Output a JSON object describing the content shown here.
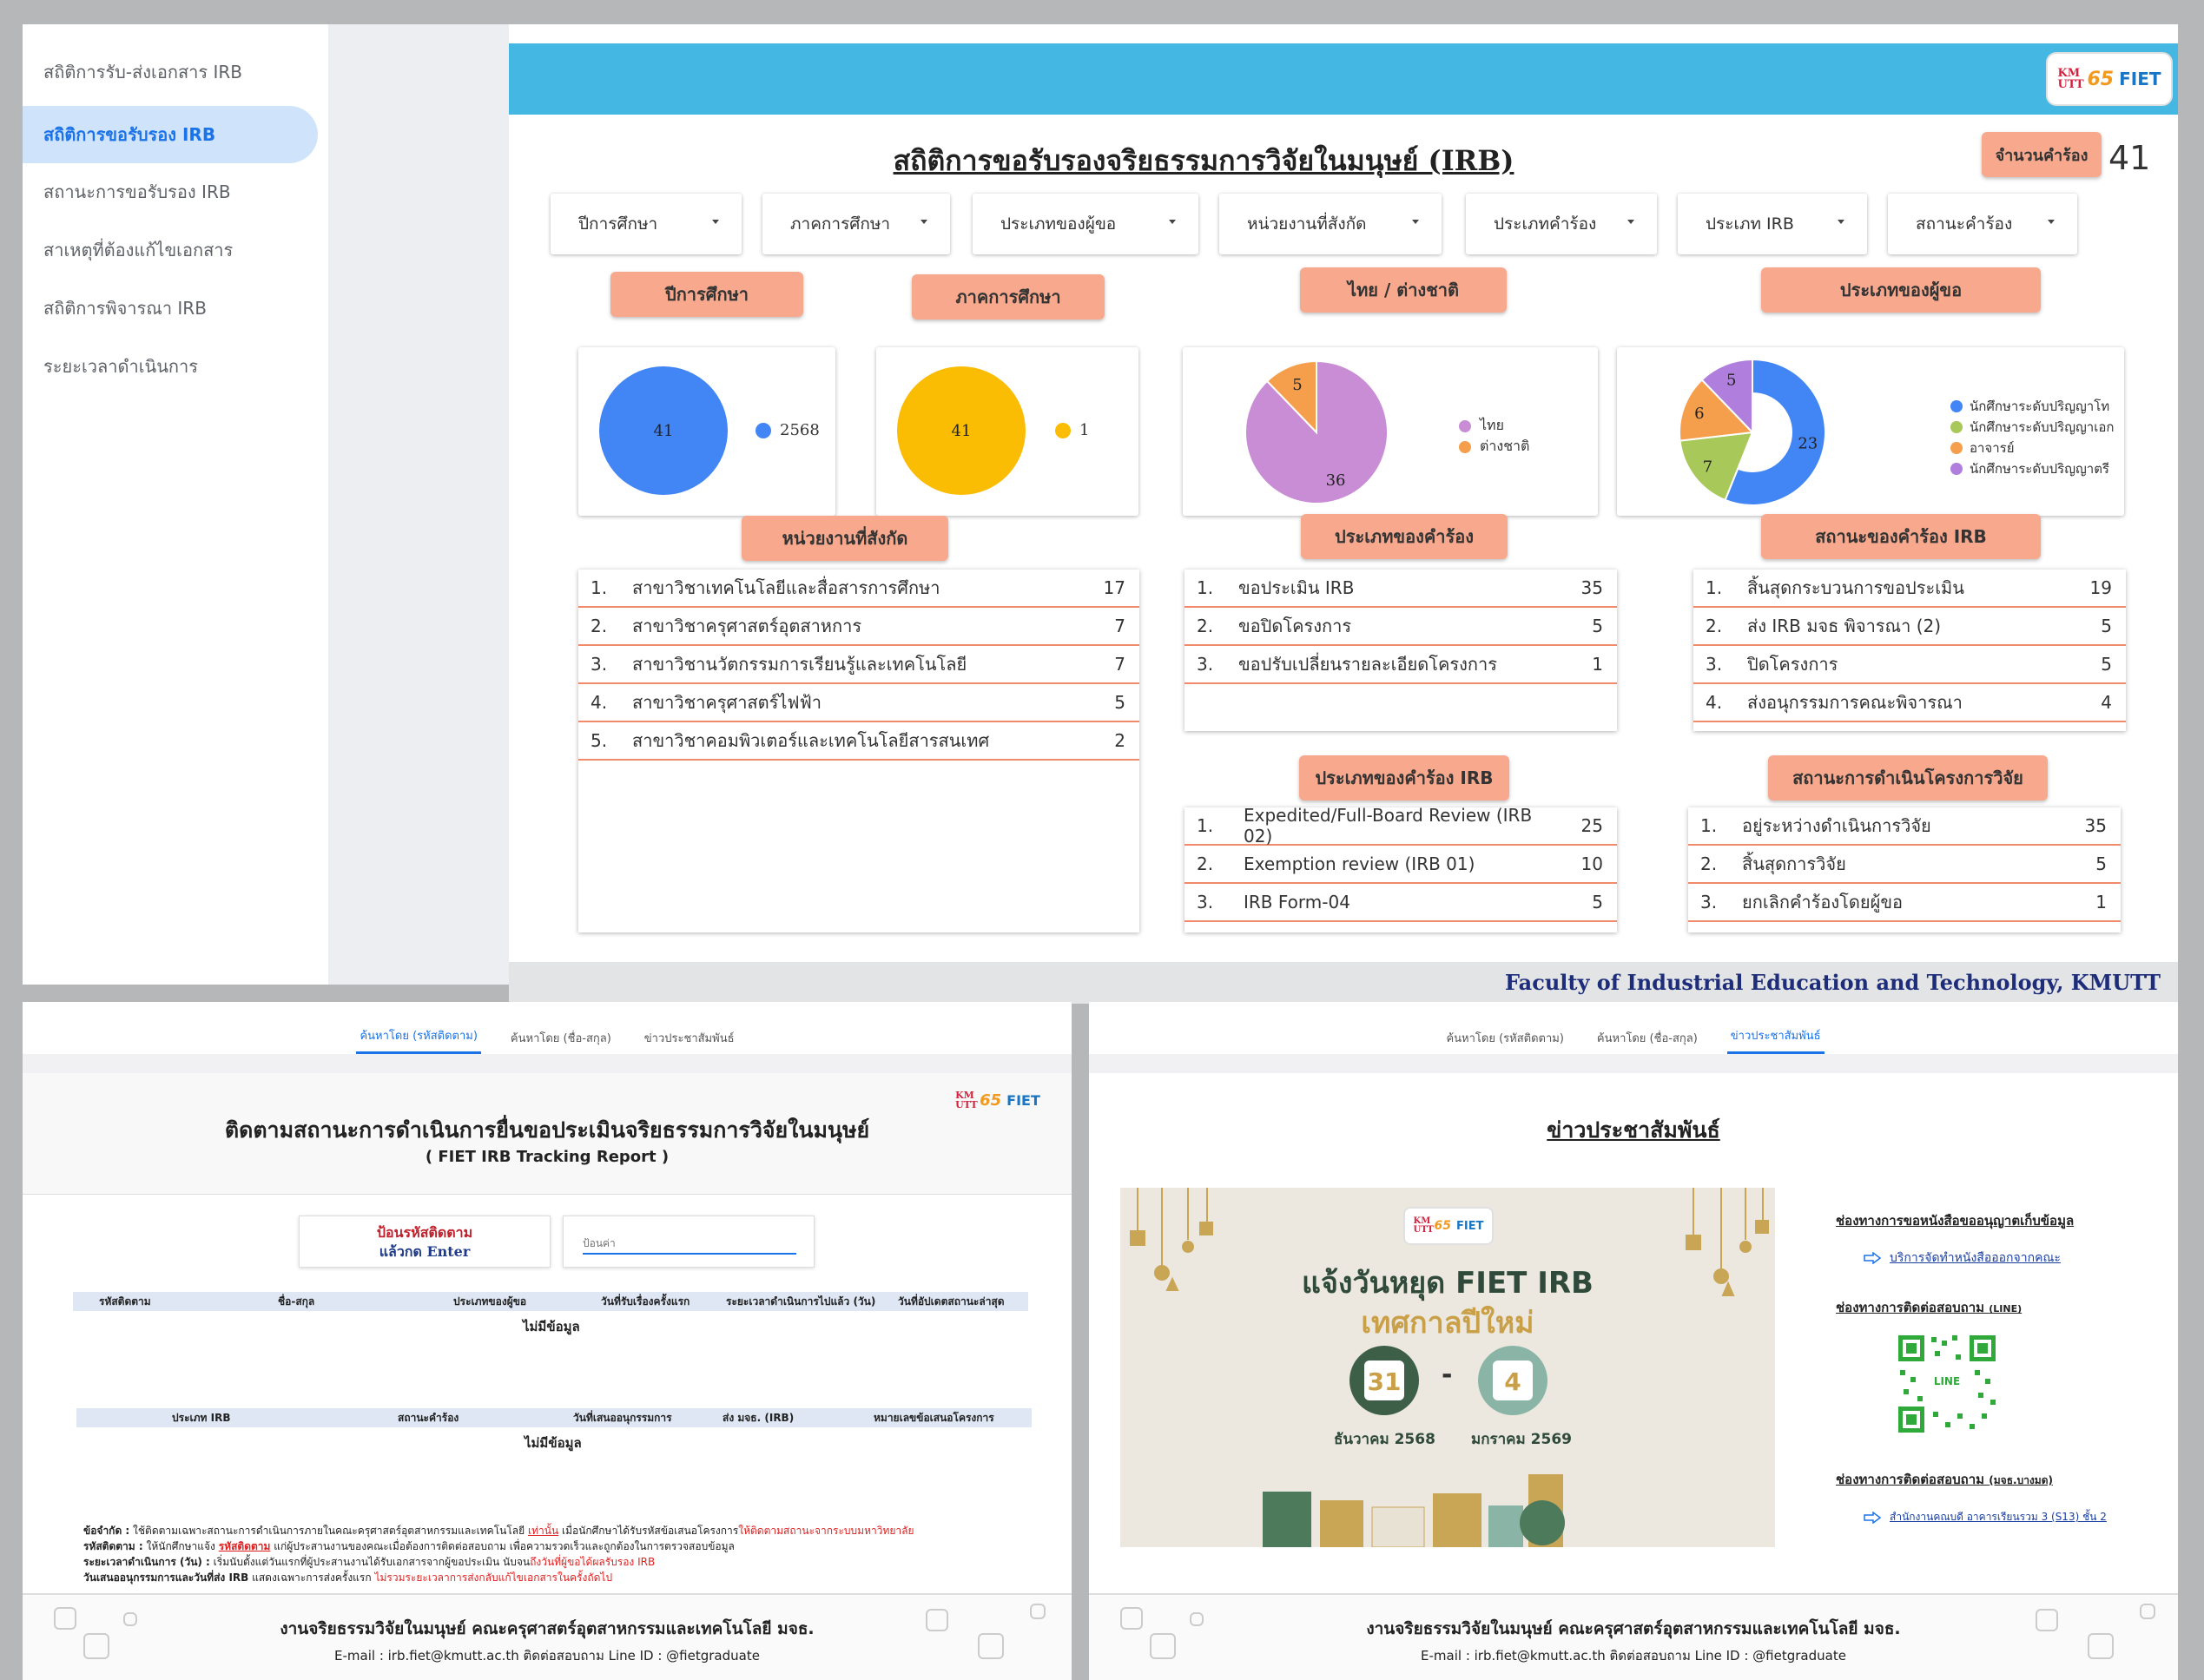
{
  "sidebar": {
    "items": [
      {
        "label": "สถิติการรับ-ส่งเอกสาร IRB",
        "active": false
      },
      {
        "label": "สถิติการขอรับรอง IRB",
        "active": true
      },
      {
        "label": "สถานะการขอรับรอง IRB",
        "active": false
      },
      {
        "label": "สาเหตุที่ต้องแก้ไขเอกสาร",
        "active": false
      },
      {
        "label": "สถิติการพิจารณา IRB",
        "active": false
      },
      {
        "label": "ระยะเวลาดำเนินการ",
        "active": false
      }
    ]
  },
  "logo": {
    "kmutt": "KM UTT",
    "anniv": "65",
    "fiet": "FIET"
  },
  "dashboard": {
    "title": "สถิติการขอรับรองจริยธรรมการวิจัยในมนุษย์ (IRB)",
    "count_label": "จำนวนคำร้อง",
    "count_value": "41",
    "filters": [
      "ปีการศึกษา",
      "ภาคการศึกษา",
      "ประเภทของผู้ขอ",
      "หน่วยงานที่สังกัด",
      "ประเภทคำร้อง",
      "ประเภท IRB",
      "สถานะคำร้อง"
    ],
    "pill_labels": {
      "year": "ปีการศึกษา",
      "semester": "ภาคการศึกษา",
      "nationality": "ไทย / ต่างชาติ",
      "applicant": "ประเภทของผู้ขอ",
      "department": "หน่วยงานที่สังกัด",
      "request_type": "ประเภทของคำร้อง",
      "request_status": "สถานะของคำร้อง IRB",
      "irb_type": "ประเภทของคำร้อง IRB",
      "project_status": "สถานะการดำเนินโครงการวิจัย"
    },
    "footer": "Faculty of Industrial Education and Technology, KMUTT"
  },
  "colors": {
    "blue": "#4285f4",
    "yellow": "#fbbc04",
    "violet": "#c98dd6",
    "orange": "#f59e4b",
    "green": "#a8c85a",
    "purple": "#b07fde",
    "banner": "#44b8e3",
    "accent_line": "#f08a6a"
  },
  "chart_data": [
    {
      "type": "pie",
      "title": "ปีการศึกษา",
      "labels": [
        "2568"
      ],
      "values": [
        41
      ],
      "colors": [
        "#4285f4"
      ]
    },
    {
      "type": "pie",
      "title": "ภาคการศึกษา",
      "labels": [
        "1"
      ],
      "values": [
        41
      ],
      "colors": [
        "#fbbc04"
      ]
    },
    {
      "type": "pie",
      "title": "ไทย / ต่างชาติ",
      "labels": [
        "ไทย",
        "ต่างชาติ"
      ],
      "values": [
        36,
        5
      ],
      "colors": [
        "#c98dd6",
        "#f59e4b"
      ]
    },
    {
      "type": "pie",
      "donut": true,
      "title": "ประเภทของผู้ขอ",
      "labels": [
        "นักศึกษาระดับปริญญาโท",
        "นักศึกษาระดับปริญญาเอก",
        "อาจารย์",
        "นักศึกษาระดับปริญญาตรี"
      ],
      "values": [
        23,
        7,
        6,
        5
      ],
      "colors": [
        "#4285f4",
        "#a8c85a",
        "#f59e4b",
        "#b07fde"
      ]
    }
  ],
  "tables": {
    "department": [
      [
        "1.",
        "สาขาวิชาเทคโนโลยีและสื่อสารการศึกษา",
        "17"
      ],
      [
        "2.",
        "สาขาวิชาครุศาสตร์อุตสาหการ",
        "7"
      ],
      [
        "3.",
        "สาขาวิชานวัตกรรมการเรียนรู้และเทคโนโลยี",
        "7"
      ],
      [
        "4.",
        "สาขาวิชาครุศาสตร์ไฟฟ้า",
        "5"
      ],
      [
        "5.",
        "สาขาวิชาคอมพิวเตอร์และเทคโนโลยีสารสนเทศ",
        "2"
      ]
    ],
    "request_type": [
      [
        "1.",
        "ขอประเมิน IRB",
        "35"
      ],
      [
        "2.",
        "ขอปิดโครงการ",
        "5"
      ],
      [
        "3.",
        "ขอปรับเปลี่ยนรายละเอียดโครงการ",
        "1"
      ]
    ],
    "request_status": [
      [
        "1.",
        "สิ้นสุดกระบวนการขอประเมิน",
        "19"
      ],
      [
        "2.",
        "ส่ง IRB มจธ พิจารณา (2)",
        "5"
      ],
      [
        "3.",
        "ปิดโครงการ",
        "5"
      ],
      [
        "4.",
        "ส่งอนุกรรมการคณะพิจารณา",
        "4"
      ]
    ],
    "irb_type": [
      [
        "1.",
        "Expedited/Full-Board Review (IRB 02)",
        "25"
      ],
      [
        "2.",
        "Exemption review (IRB 01)",
        "10"
      ],
      [
        "3.",
        "IRB Form-04",
        "5"
      ]
    ],
    "project_status": [
      [
        "1.",
        "อยู่ระหว่างดำเนินการวิจัย",
        "35"
      ],
      [
        "2.",
        "สิ้นสุดการวิจัย",
        "5"
      ],
      [
        "3.",
        "ยกเลิกคำร้องโดยผู้ขอ",
        "1"
      ]
    ]
  },
  "tracking": {
    "tabs": [
      "ค้นหาโดย (รหัสติดตาม)",
      "ค้นหาโดย (ชื่อ-สกุล)",
      "ข่าวประชาสัมพันธ์"
    ],
    "title": "ติดตามสถานะการดำเนินการยื่นขอประเมินจริยธรรมการวิจัยในมนุษย์",
    "subtitle": "( FIET IRB Tracking Report )",
    "input_label_1": "ป้อนรหัสติดตาม",
    "input_label_2": "แล้วกด Enter",
    "input_placeholder": "ป้อนค่า",
    "table1_headers": [
      "รหัสติดตาม",
      "ชื่อ-สกุล",
      "ประเภทของผู้ขอ",
      "วันที่รับเรื่องครั้งแรก",
      "ระยะเวลาดำเนินการไปแล้ว (วัน)",
      "วันที่อัปเดตสถานะล่าสุด"
    ],
    "table2_headers": [
      "ประเภท IRB",
      "สถานะคำร้อง",
      "วันที่เสนออนุกรรมการ",
      "ส่ง มจธ. (IRB)",
      "หมายเลขข้อเสนอโครงการ"
    ],
    "no_data": "ไม่มีข้อมูล",
    "notes": [
      {
        "label": "ข้อจำกัด :",
        "text": " ใช้ติดตามเฉพาะสถานะการดำเนินการภายในคณะครุศาสตร์อุตสาหกรรมและเทคโนโลยี ",
        "red1": "เท่านั้น",
        "text2": " เมื่อนักศึกษาได้รับรหัสข้อเสนอโครงการ",
        "red2": "ให้ติดตามสถานะจากระบบมหาวิทยาลัย"
      },
      {
        "label": "รหัสติดตาม :",
        "text": " ให้นักศึกษาแจ้ง ",
        "red1": "รหัสติดตาม",
        "text2": " แก่ผู้ประสานงานของคณะเมื่อต้องการติดต่อสอบถาม เพื่อความรวดเร็วและถูกต้องในการตรวจสอบข้อมูล",
        "red2": ""
      },
      {
        "label": "ระยะเวลาดำเนินการ (วัน) :",
        "text": " เริ่มนับตั้งแต่วันแรกที่ผู้ประสานงานได้รับเอกสารจากผู้ขอประเมิน นับจน",
        "red1": "ถึงวันที่ผู้ขอได้ผลรับรอง IRB",
        "text2": "",
        "red2": ""
      },
      {
        "label": "วันเสนออนุกรรมการและวันที่ส่ง IRB",
        "text": " แสดงเฉพาะการส่งครั้งแรก ",
        "red1": "ไม่รวมระยะเวลาการส่งกลับแก้ไขเอกสารในครั้งถัดไป",
        "text2": "",
        "red2": ""
      }
    ],
    "footer_1": "งานจริยธรรมวิจัยในมนุษย์ คณะครุศาสตร์อุตสาหกรรมและเทคโนโลยี มจธ.",
    "footer_2": "E-mail : irb.fiet@kmutt.ac.th  ติดต่อสอบถาม Line ID : @fietgraduate"
  },
  "news": {
    "title": "ข่าวประชาสัมพันธ์",
    "poster": {
      "headline": "แจ้งวันหยุด FIET IRB",
      "subheadline": "เทศกาลปีใหม่",
      "day1": "31",
      "month1": "ธันวาคม 2568",
      "dash": "-",
      "day2": "4",
      "month2": "มกราคม 2569"
    },
    "section1": "ช่องทางการขอหนังสือขออนุญาตเก็บข้อมูล",
    "link1": "บริการจัดทำหนังสือออกจากคณะ",
    "section2": "ช่องทางการติดต่อสอบถาม",
    "section2_sub": "(LINE)",
    "qr_label": "LINE",
    "section3": "ช่องทางการติดต่อสอบถาม",
    "section3_sub": "(มจธ.บางมด)",
    "link3": "สำนักงานคณบดี อาคารเรียนรวม 3 (S13) ชั้น 2"
  }
}
